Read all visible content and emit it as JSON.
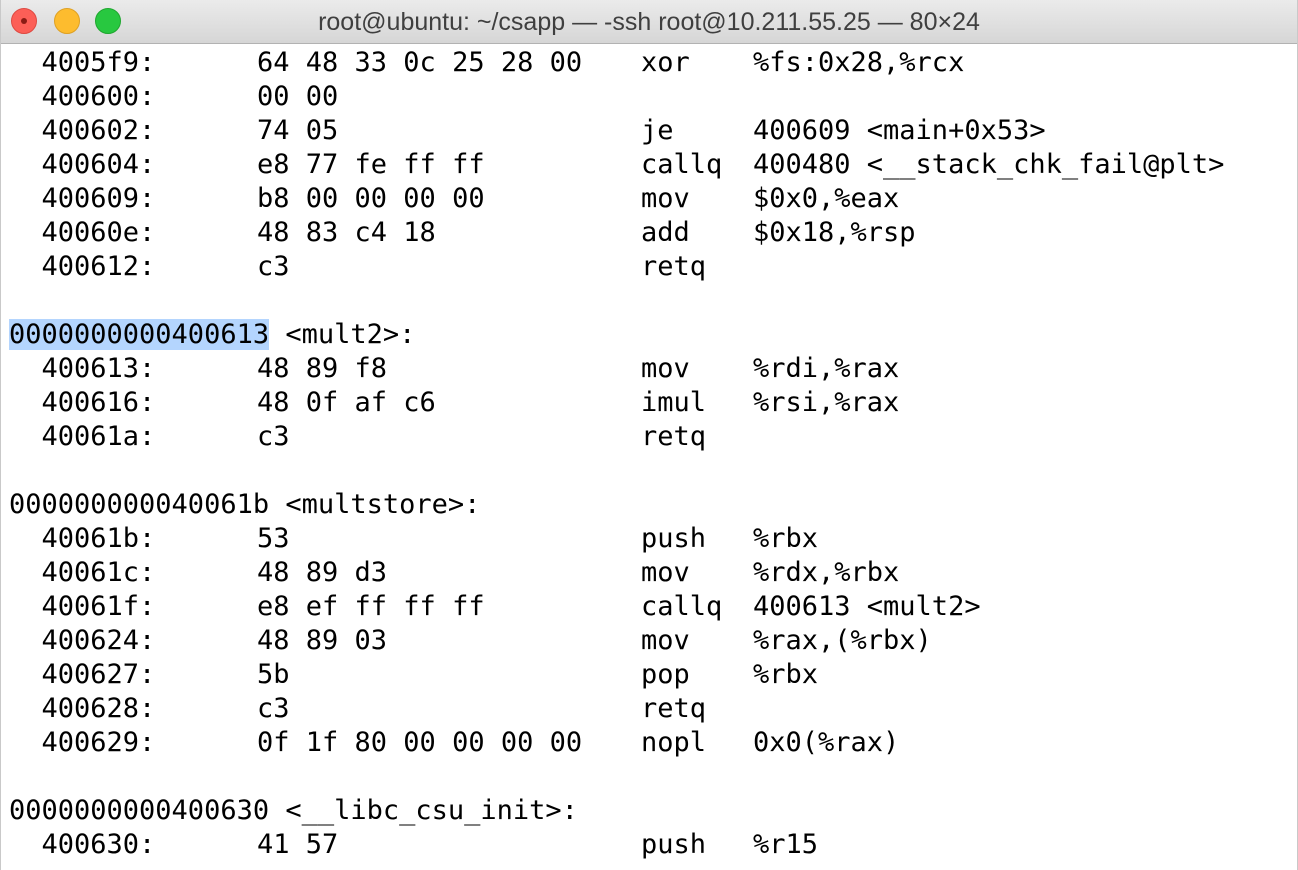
{
  "window": {
    "title": "root@ubuntu: ~/csapp — -ssh root@10.211.55.25 — 80×24"
  },
  "lines": [
    {
      "type": "insn",
      "addr": "  4005f9:",
      "bytes": "64 48 33 0c 25 28 00",
      "mnemonic": "xor",
      "operands": "%fs:0x28,%rcx"
    },
    {
      "type": "insn",
      "addr": "  400600:",
      "bytes": "00 00",
      "mnemonic": "",
      "operands": ""
    },
    {
      "type": "insn",
      "addr": "  400602:",
      "bytes": "74 05",
      "mnemonic": "je",
      "operands": "400609 <main+0x53>"
    },
    {
      "type": "insn",
      "addr": "  400604:",
      "bytes": "e8 77 fe ff ff",
      "mnemonic": "callq",
      "operands": "400480 <__stack_chk_fail@plt>"
    },
    {
      "type": "insn",
      "addr": "  400609:",
      "bytes": "b8 00 00 00 00",
      "mnemonic": "mov",
      "operands": "$0x0,%eax"
    },
    {
      "type": "insn",
      "addr": "  40060e:",
      "bytes": "48 83 c4 18",
      "mnemonic": "add",
      "operands": "$0x18,%rsp"
    },
    {
      "type": "insn",
      "addr": "  400612:",
      "bytes": "c3",
      "mnemonic": "retq",
      "operands": ""
    },
    {
      "type": "blank"
    },
    {
      "type": "label",
      "selected": "0000000000400613",
      "text": " <mult2>:"
    },
    {
      "type": "insn",
      "addr": "  400613:",
      "bytes": "48 89 f8",
      "mnemonic": "mov",
      "operands": "%rdi,%rax"
    },
    {
      "type": "insn",
      "addr": "  400616:",
      "bytes": "48 0f af c6",
      "mnemonic": "imul",
      "operands": "%rsi,%rax"
    },
    {
      "type": "insn",
      "addr": "  40061a:",
      "bytes": "c3",
      "mnemonic": "retq",
      "operands": ""
    },
    {
      "type": "blank"
    },
    {
      "type": "label",
      "selected": "",
      "text": "000000000040061b <multstore>:"
    },
    {
      "type": "insn",
      "addr": "  40061b:",
      "bytes": "53",
      "mnemonic": "push",
      "operands": "%rbx"
    },
    {
      "type": "insn",
      "addr": "  40061c:",
      "bytes": "48 89 d3",
      "mnemonic": "mov",
      "operands": "%rdx,%rbx"
    },
    {
      "type": "insn",
      "addr": "  40061f:",
      "bytes": "e8 ef ff ff ff",
      "mnemonic": "callq",
      "operands": "400613 <mult2>"
    },
    {
      "type": "insn",
      "addr": "  400624:",
      "bytes": "48 89 03",
      "mnemonic": "mov",
      "operands": "%rax,(%rbx)"
    },
    {
      "type": "insn",
      "addr": "  400627:",
      "bytes": "5b",
      "mnemonic": "pop",
      "operands": "%rbx"
    },
    {
      "type": "insn",
      "addr": "  400628:",
      "bytes": "c3",
      "mnemonic": "retq",
      "operands": ""
    },
    {
      "type": "insn",
      "addr": "  400629:",
      "bytes": "0f 1f 80 00 00 00 00",
      "mnemonic": "nopl",
      "operands": "0x0(%rax)"
    },
    {
      "type": "blank"
    },
    {
      "type": "label",
      "selected": "",
      "text": "0000000000400630 <__libc_csu_init>:"
    },
    {
      "type": "insn",
      "addr": "  400630:",
      "bytes": "41 57",
      "mnemonic": "push",
      "operands": "%r15"
    }
  ],
  "colors": {
    "selection": "#b4d5fe",
    "close": "#fc5f57",
    "minimize": "#fdbc2e",
    "maximize": "#28c840"
  }
}
